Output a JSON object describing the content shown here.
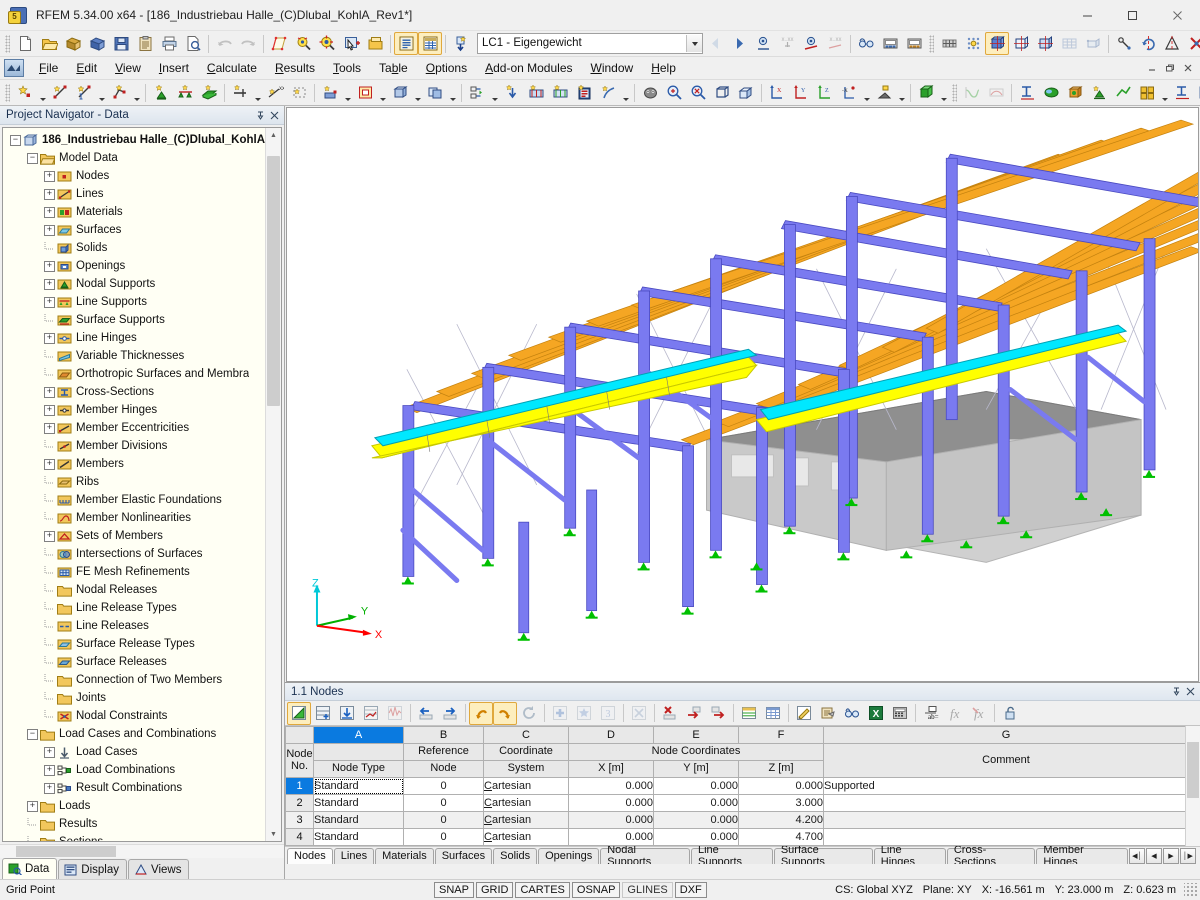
{
  "window": {
    "title": "RFEM 5.34.00 x64 - [186_Industriebau Halle_(C)Dlubal_KohlA_Rev1*]",
    "minimize": "—",
    "maximize": "☐",
    "close": "✕",
    "app_icon": "rfem-app-icon",
    "mdi_minimize": "–",
    "mdi_restore": "❐",
    "mdi_close": "✕"
  },
  "menu": {
    "logo": "rfem-logo-icon",
    "items": [
      {
        "label": "File"
      },
      {
        "label": "Edit"
      },
      {
        "label": "View"
      },
      {
        "label": "Insert"
      },
      {
        "label": "Calculate"
      },
      {
        "label": "Results"
      },
      {
        "label": "Tools"
      },
      {
        "label": "Table"
      },
      {
        "label": "Options"
      },
      {
        "label": "Add-on Modules"
      },
      {
        "label": "Window"
      },
      {
        "label": "Help"
      }
    ]
  },
  "toolbar_main": {
    "load_case_value": "LC1 - Eigengewicht",
    "buttons": [
      {
        "name": "new-file-button",
        "tip": "New Model"
      },
      {
        "name": "open-file-button",
        "tip": "Open"
      },
      {
        "name": "save-as-button",
        "tip": "Save As"
      },
      {
        "name": "export-button",
        "tip": "Export"
      },
      {
        "name": "save-button",
        "tip": "Save"
      },
      {
        "name": "clipboard-button",
        "tip": "Clipboard"
      },
      {
        "name": "print-button",
        "tip": "Print"
      },
      {
        "name": "print-preview-button",
        "tip": "Print Preview"
      },
      {
        "name": "undo-button",
        "tip": "Undo"
      },
      {
        "name": "redo-button",
        "tip": "Redo"
      },
      {
        "name": "render-button",
        "tip": "Rendering"
      },
      {
        "name": "zoom-select-button",
        "tip": "Zoom Selection"
      },
      {
        "name": "zoom-all-button",
        "tip": "Show Whole Model"
      },
      {
        "name": "select-button",
        "tip": "Select Objects"
      },
      {
        "name": "visibility-button",
        "tip": "Visibility"
      },
      {
        "name": "table-view-button",
        "tip": "Tables"
      },
      {
        "name": "grid-view-button",
        "tip": "Display Tables"
      },
      {
        "name": "load-case-add-button",
        "tip": "New Load Case"
      }
    ]
  },
  "viewport": {
    "axis_labels": {
      "x": "X",
      "y": "Y",
      "z": "Z"
    },
    "colors": {
      "member_steel": "#7a7af0",
      "member_timber": "#f5a623",
      "surface_gray": "#c8c8c8",
      "surface_dark": "#8f8f8f",
      "highlight_yellow": "#ffff00",
      "highlight_cyan": "#00e8ff",
      "support_green": "#00c000",
      "axis_x": "#ff0000",
      "axis_y": "#00b000",
      "axis_z": "#00c8d8",
      "background": "#ffffff"
    }
  },
  "table_panel": {
    "title": "1.1 Nodes",
    "pin": "⇲",
    "close": "✕",
    "toolbar_buttons": [
      {
        "name": "edit-table-button"
      },
      {
        "name": "insert-row-button"
      },
      {
        "name": "import-button"
      },
      {
        "name": "table-settings-button"
      },
      {
        "name": "table-filter-button"
      },
      {
        "name": "prev-table-button"
      },
      {
        "name": "next-table-button"
      },
      {
        "name": "undo-table-button"
      },
      {
        "name": "redo-table-button"
      },
      {
        "name": "refresh-button"
      },
      {
        "name": "add-row-button"
      },
      {
        "name": "modify-row-button"
      },
      {
        "name": "info-row-button"
      },
      {
        "name": "clear-table-button"
      },
      {
        "name": "delete-row-button"
      },
      {
        "name": "insert-before-button"
      },
      {
        "name": "insert-after-button"
      },
      {
        "name": "color-table-button"
      },
      {
        "name": "grid-lines-button"
      },
      {
        "name": "edit-cell-button"
      },
      {
        "name": "print-table-button"
      },
      {
        "name": "view-mode-button"
      },
      {
        "name": "excel-export-button"
      },
      {
        "name": "calculator-button"
      },
      {
        "name": "units-button"
      },
      {
        "name": "formula-button"
      },
      {
        "name": "clear-formula-button"
      },
      {
        "name": "lock-table-button"
      }
    ],
    "columns": [
      {
        "letter": "A",
        "title": "Node Type",
        "subtitle": "",
        "selected": true
      },
      {
        "letter": "B",
        "title": "Reference",
        "subtitle": "Node",
        "selected": false
      },
      {
        "letter": "C",
        "title": "Coordinate",
        "subtitle": "System",
        "selected": false
      },
      {
        "letter": "D",
        "title": "",
        "subtitle": "X [m]",
        "selected": false
      },
      {
        "letter": "E",
        "title": "",
        "subtitle": "Y [m]",
        "selected": false
      },
      {
        "letter": "F",
        "title": "",
        "subtitle": "Z [m]",
        "selected": false
      },
      {
        "letter": "G",
        "title": "",
        "subtitle": "Comment",
        "selected": false
      }
    ],
    "group_header": "Node Coordinates",
    "rownum_header_line1": "Node",
    "rownum_header_line2": "No.",
    "rows": [
      {
        "no": "1",
        "node_type": "Standard",
        "reference_node": "0",
        "coordinate_system": "Cartesian",
        "x": "0.000",
        "y": "0.000",
        "z": "0.000",
        "comment": "Supported",
        "selected": true
      },
      {
        "no": "2",
        "node_type": "Standard",
        "reference_node": "0",
        "coordinate_system": "Cartesian",
        "x": "0.000",
        "y": "0.000",
        "z": "3.000",
        "comment": "",
        "selected": false
      },
      {
        "no": "3",
        "node_type": "Standard",
        "reference_node": "0",
        "coordinate_system": "Cartesian",
        "x": "0.000",
        "y": "0.000",
        "z": "4.200",
        "comment": "",
        "selected": false
      },
      {
        "no": "4",
        "node_type": "Standard",
        "reference_node": "0",
        "coordinate_system": "Cartesian",
        "x": "0.000",
        "y": "0.000",
        "z": "4.700",
        "comment": "",
        "selected": false
      }
    ],
    "tabs": [
      {
        "label": "Nodes",
        "selected": true
      },
      {
        "label": "Lines",
        "selected": false
      },
      {
        "label": "Materials",
        "selected": false
      },
      {
        "label": "Surfaces",
        "selected": false
      },
      {
        "label": "Solids",
        "selected": false
      },
      {
        "label": "Openings",
        "selected": false
      },
      {
        "label": "Nodal Supports",
        "selected": false
      },
      {
        "label": "Line Supports",
        "selected": false
      },
      {
        "label": "Surface Supports",
        "selected": false
      },
      {
        "label": "Line Hinges",
        "selected": false
      },
      {
        "label": "Cross-Sections",
        "selected": false
      },
      {
        "label": "Member Hinges",
        "selected": false
      }
    ],
    "tab_nav": [
      {
        "name": "first-tab-button",
        "glyph": "◀│"
      },
      {
        "name": "prev-tab-button",
        "glyph": "◀"
      },
      {
        "name": "next-tab-button",
        "glyph": "▶"
      },
      {
        "name": "last-tab-button",
        "glyph": "│▶"
      }
    ]
  },
  "navigator": {
    "header": "Project Navigator - Data",
    "pin": "⇲",
    "close": "✕",
    "tree": [
      {
        "label": "186_Industriebau Halle_(C)Dlubal_KohlA",
        "depth": 0,
        "expander": "minus",
        "icon": "model-icon",
        "bold": true
      },
      {
        "label": "Model Data",
        "depth": 1,
        "expander": "minus",
        "icon": "folder-open-icon",
        "bold": false
      },
      {
        "label": "Nodes",
        "depth": 2,
        "expander": "plus",
        "icon": "nodes-icon",
        "bold": false
      },
      {
        "label": "Lines",
        "depth": 2,
        "expander": "plus",
        "icon": "lines-icon",
        "bold": false
      },
      {
        "label": "Materials",
        "depth": 2,
        "expander": "plus",
        "icon": "materials-icon",
        "bold": false
      },
      {
        "label": "Surfaces",
        "depth": 2,
        "expander": "plus",
        "icon": "surfaces-icon",
        "bold": false
      },
      {
        "label": "Solids",
        "depth": 2,
        "expander": "none",
        "icon": "solids-icon",
        "bold": false
      },
      {
        "label": "Openings",
        "depth": 2,
        "expander": "plus",
        "icon": "openings-icon",
        "bold": false
      },
      {
        "label": "Nodal Supports",
        "depth": 2,
        "expander": "plus",
        "icon": "nodal-supports-icon",
        "bold": false
      },
      {
        "label": "Line Supports",
        "depth": 2,
        "expander": "plus",
        "icon": "line-supports-icon",
        "bold": false
      },
      {
        "label": "Surface Supports",
        "depth": 2,
        "expander": "none",
        "icon": "surface-supports-icon",
        "bold": false
      },
      {
        "label": "Line Hinges",
        "depth": 2,
        "expander": "plus",
        "icon": "line-hinges-icon",
        "bold": false
      },
      {
        "label": "Variable Thicknesses",
        "depth": 2,
        "expander": "none",
        "icon": "variable-thicknesses-icon",
        "bold": false
      },
      {
        "label": "Orthotropic Surfaces and Membra",
        "depth": 2,
        "expander": "none",
        "icon": "orthotropic-icon",
        "bold": false
      },
      {
        "label": "Cross-Sections",
        "depth": 2,
        "expander": "plus",
        "icon": "cross-sections-icon",
        "bold": false
      },
      {
        "label": "Member Hinges",
        "depth": 2,
        "expander": "plus",
        "icon": "member-hinges-icon",
        "bold": false
      },
      {
        "label": "Member Eccentricities",
        "depth": 2,
        "expander": "plus",
        "icon": "member-eccentricities-icon",
        "bold": false
      },
      {
        "label": "Member Divisions",
        "depth": 2,
        "expander": "none",
        "icon": "member-divisions-icon",
        "bold": false
      },
      {
        "label": "Members",
        "depth": 2,
        "expander": "plus",
        "icon": "members-icon",
        "bold": false
      },
      {
        "label": "Ribs",
        "depth": 2,
        "expander": "none",
        "icon": "ribs-icon",
        "bold": false
      },
      {
        "label": "Member Elastic Foundations",
        "depth": 2,
        "expander": "none",
        "icon": "member-elastic-foundations-icon",
        "bold": false
      },
      {
        "label": "Member Nonlinearities",
        "depth": 2,
        "expander": "none",
        "icon": "member-nonlinearities-icon",
        "bold": false
      },
      {
        "label": "Sets of Members",
        "depth": 2,
        "expander": "plus",
        "icon": "sets-of-members-icon",
        "bold": false
      },
      {
        "label": "Intersections of Surfaces",
        "depth": 2,
        "expander": "none",
        "icon": "intersections-icon",
        "bold": false
      },
      {
        "label": "FE Mesh Refinements",
        "depth": 2,
        "expander": "none",
        "icon": "fe-mesh-refinements-icon",
        "bold": false
      },
      {
        "label": "Nodal Releases",
        "depth": 2,
        "expander": "none",
        "icon": "folder-icon",
        "bold": false
      },
      {
        "label": "Line Release Types",
        "depth": 2,
        "expander": "none",
        "icon": "folder-icon",
        "bold": false
      },
      {
        "label": "Line Releases",
        "depth": 2,
        "expander": "none",
        "icon": "line-releases-icon",
        "bold": false
      },
      {
        "label": "Surface Release Types",
        "depth": 2,
        "expander": "none",
        "icon": "surface-release-types-icon",
        "bold": false
      },
      {
        "label": "Surface Releases",
        "depth": 2,
        "expander": "none",
        "icon": "surface-releases-icon",
        "bold": false
      },
      {
        "label": "Connection of Two Members",
        "depth": 2,
        "expander": "none",
        "icon": "folder-icon",
        "bold": false
      },
      {
        "label": "Joints",
        "depth": 2,
        "expander": "none",
        "icon": "folder-icon",
        "bold": false
      },
      {
        "label": "Nodal Constraints",
        "depth": 2,
        "expander": "none",
        "icon": "nodal-constraints-icon",
        "bold": false
      },
      {
        "label": "Load Cases and Combinations",
        "depth": 1,
        "expander": "minus",
        "icon": "folder-icon",
        "bold": false
      },
      {
        "label": "Load Cases",
        "depth": 2,
        "expander": "plus",
        "icon": "load-cases-icon",
        "bold": false
      },
      {
        "label": "Load Combinations",
        "depth": 2,
        "expander": "plus",
        "icon": "load-combinations-icon",
        "bold": false
      },
      {
        "label": "Result Combinations",
        "depth": 2,
        "expander": "plus",
        "icon": "result-combinations-icon",
        "bold": false
      },
      {
        "label": "Loads",
        "depth": 1,
        "expander": "plus",
        "icon": "folder-icon",
        "bold": false
      },
      {
        "label": "Results",
        "depth": 1,
        "expander": "none",
        "icon": "folder-icon",
        "bold": false
      },
      {
        "label": "Sections",
        "depth": 1,
        "expander": "none",
        "icon": "folder-icon",
        "bold": false
      }
    ],
    "tabs": [
      {
        "label": "Data",
        "icon": "data-icon",
        "selected": true
      },
      {
        "label": "Display",
        "icon": "display-icon",
        "selected": false
      },
      {
        "label": "Views",
        "icon": "views-icon",
        "selected": false
      }
    ]
  },
  "statusbar": {
    "message": "Grid Point",
    "flags": [
      {
        "label": "SNAP",
        "on": true
      },
      {
        "label": "GRID",
        "on": true
      },
      {
        "label": "CARTES",
        "on": true
      },
      {
        "label": "OSNAP",
        "on": true
      },
      {
        "label": "GLINES",
        "on": false
      },
      {
        "label": "DXF",
        "on": true
      }
    ],
    "cs": "CS: Global XYZ",
    "plane": "Plane: XY",
    "coord_x": "X: -16.561 m",
    "coord_y": "Y: 23.000 m",
    "coord_z": "Z: 0.623 m"
  }
}
